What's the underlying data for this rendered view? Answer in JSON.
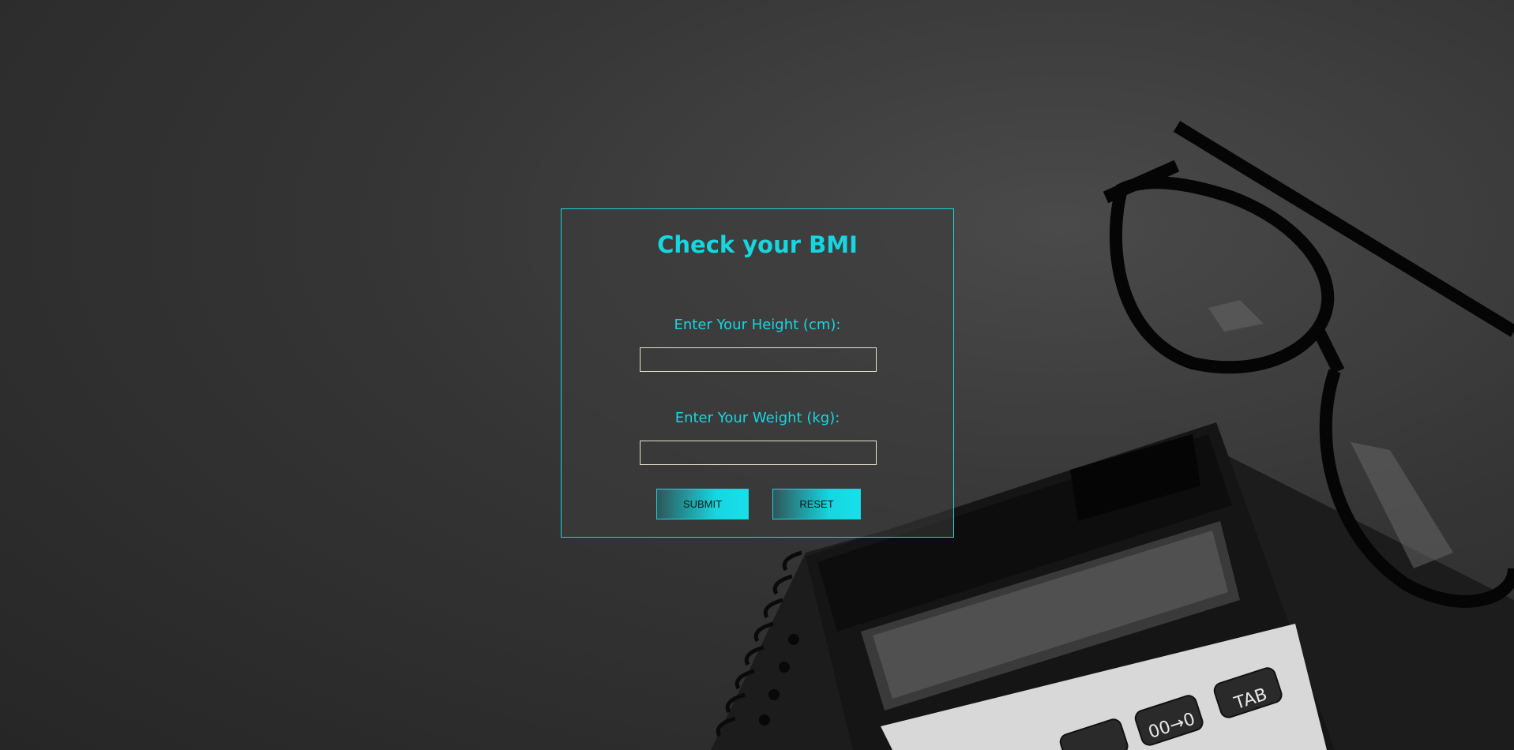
{
  "form": {
    "title": "Check your BMI",
    "height_label": "Enter Your Height (cm):",
    "height_value": "",
    "weight_label": "Enter Your Weight (kg):",
    "weight_value": "",
    "submit_label": "SUBMIT",
    "reset_label": "RESET"
  },
  "colors": {
    "accent": "#17d6e0",
    "background": "#353535",
    "input_border": "#e6e0cc"
  },
  "icons": [
    "glasses-image",
    "calculator-image",
    "notebook-spiral-image"
  ]
}
